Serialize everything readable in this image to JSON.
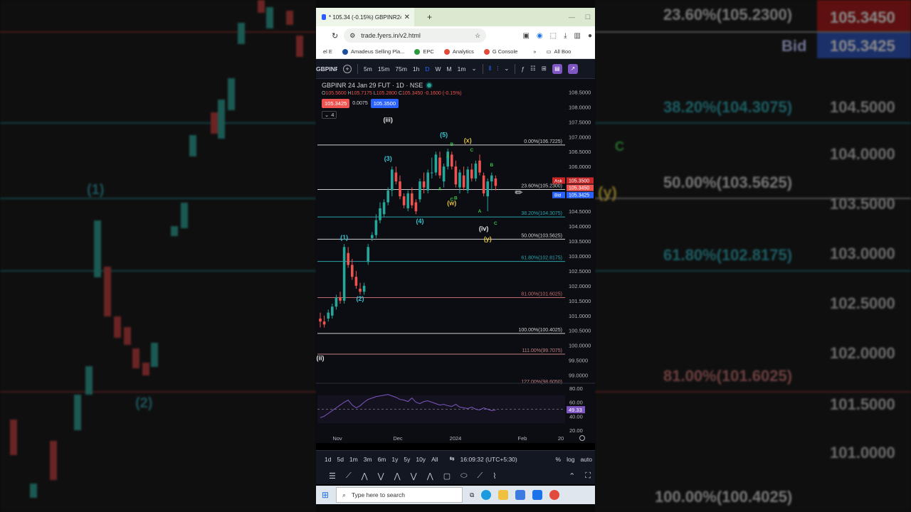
{
  "backdrop_left": {
    "labels": [
      {
        "text": "(1)",
        "color": "#2a8f9a"
      },
      {
        "text": "(2)",
        "color": "#2a8f9a"
      }
    ]
  },
  "backdrop_right": {
    "labels": [
      {
        "text": "23.60%(105.2300)",
        "color": "#d0d0d0"
      },
      {
        "text": "38.20%(104.3075)",
        "color": "#2aa3ad"
      },
      {
        "text": "50.00%(103.5625)",
        "color": "#d0d0d0"
      },
      {
        "text": "61.80%(102.8175)",
        "color": "#2aa3ad"
      },
      {
        "text": "81.00%(101.6025)",
        "color": "#c06b6b"
      },
      {
        "text": "100.00%(100.4025)",
        "color": "#d0d0d0"
      }
    ],
    "prices": [
      "104.5000",
      "104.0000",
      "103.5000",
      "103.0000",
      "102.5000",
      "102.0000",
      "101.5000",
      "101.0000"
    ],
    "bid_label": "Bid",
    "bid_value": "105.3425",
    "top_value": "105.3450",
    "wave_c": "C",
    "wave_y": "(y)"
  },
  "browser": {
    "tab_title": "* 105.34 (-0.15%) GBPINR24JAN",
    "url": "trade.fyers.in/v2.html",
    "bookmarks": [
      "el E",
      "Amadeus Selling Pla...",
      "EPC",
      "Analytics",
      "G Console",
      "All Boo"
    ]
  },
  "toolbar": {
    "symbol": "GBPINR",
    "intervals": [
      "5m",
      "15m",
      "75m",
      "1h",
      "D",
      "W",
      "M",
      "1m"
    ],
    "active_interval": "D"
  },
  "chart_header": {
    "title": "GBPINR 24 Jan 29 FUT · 1D · NSE",
    "o_label": "O",
    "o_value": "105.5600",
    "h_label": "H",
    "h_value": "105.7175",
    "l_label": "L",
    "l_value": "105.2800",
    "c_label": "C",
    "c_value": "105.3450",
    "change": "-0.1600 (-0.15%)",
    "sell_price": "105.3425",
    "spread": "0.0075",
    "buy_price": "105.3500",
    "indicator_count": "4"
  },
  "chart_data": {
    "type": "candlestick",
    "title": "GBPINR 24 Jan 29 FUT · 1D · NSE",
    "y_ticks": [
      "108.5000",
      "108.0000",
      "107.5000",
      "107.0000",
      "106.5000",
      "106.0000",
      "105.5000",
      "105.0000",
      "104.5000",
      "104.0000",
      "103.5000",
      "103.0000",
      "102.5000",
      "102.0000",
      "101.5000",
      "101.0000",
      "100.5000",
      "100.0000",
      "99.5000",
      "99.0000"
    ],
    "x_ticks": [
      "Nov",
      "Dec",
      "2024",
      "Feb",
      "20"
    ],
    "ylim": [
      98.8,
      108.7
    ],
    "candles": [
      [
        100.9,
        101.1,
        100.6,
        100.8
      ],
      [
        100.8,
        101.0,
        100.6,
        100.7
      ],
      [
        100.9,
        101.2,
        100.8,
        101.1
      ],
      [
        101.0,
        101.4,
        100.9,
        101.3
      ],
      [
        101.3,
        101.7,
        101.2,
        101.6
      ],
      [
        101.6,
        101.8,
        101.4,
        101.5
      ],
      [
        101.5,
        103.4,
        101.4,
        103.3
      ],
      [
        103.1,
        103.3,
        102.6,
        102.7
      ],
      [
        102.7,
        102.9,
        102.2,
        102.3
      ],
      [
        102.3,
        102.5,
        101.9,
        102.0
      ],
      [
        101.9,
        102.1,
        101.7,
        101.8
      ],
      [
        101.8,
        102.1,
        101.7,
        102.0
      ],
      [
        102.8,
        103.4,
        102.7,
        103.3
      ],
      [
        103.6,
        103.8,
        103.5,
        103.7
      ],
      [
        103.7,
        104.4,
        103.6,
        104.2
      ],
      [
        104.2,
        104.8,
        104.1,
        104.6
      ],
      [
        104.4,
        104.9,
        104.3,
        104.8
      ],
      [
        104.8,
        105.3,
        104.7,
        105.2
      ],
      [
        105.2,
        106.0,
        105.0,
        105.9
      ],
      [
        105.8,
        106.0,
        105.4,
        105.5
      ],
      [
        105.5,
        105.7,
        104.9,
        105.0
      ],
      [
        105.0,
        105.1,
        104.6,
        104.7
      ],
      [
        104.6,
        105.2,
        104.5,
        105.1
      ],
      [
        105.1,
        105.3,
        104.6,
        104.7
      ],
      [
        104.8,
        104.9,
        104.4,
        104.5
      ],
      [
        104.9,
        105.6,
        104.8,
        105.5
      ],
      [
        105.5,
        105.8,
        105.1,
        105.3
      ],
      [
        105.2,
        105.9,
        105.1,
        105.8
      ],
      [
        105.8,
        106.3,
        105.6,
        105.8
      ],
      [
        105.8,
        106.5,
        105.7,
        106.4
      ],
      [
        106.3,
        106.5,
        105.6,
        105.7
      ],
      [
        105.5,
        106.1,
        105.3,
        106.0
      ],
      [
        106.0,
        106.6,
        105.9,
        106.5
      ],
      [
        106.4,
        106.5,
        105.9,
        106.0
      ],
      [
        106.0,
        106.2,
        105.3,
        105.4
      ],
      [
        105.3,
        105.9,
        105.1,
        105.8
      ],
      [
        105.7,
        106.0,
        105.2,
        105.3
      ],
      [
        105.2,
        106.0,
        105.1,
        105.9
      ],
      [
        105.9,
        106.1,
        105.5,
        105.6
      ],
      [
        105.6,
        106.2,
        105.5,
        106.1
      ],
      [
        106.2,
        106.4,
        105.7,
        105.8
      ],
      [
        105.7,
        105.8,
        105.0,
        105.1
      ],
      [
        105.0,
        105.6,
        104.5,
        105.5
      ],
      [
        105.5,
        105.8,
        105.2,
        105.7
      ],
      [
        105.6,
        105.7,
        105.2,
        105.35
      ]
    ],
    "fib_levels": [
      {
        "label": "0.00%(106.7225)",
        "price": 106.7225,
        "color": "#cfcfcf"
      },
      {
        "label": "23.60%(105.2300)",
        "price": 105.23,
        "color": "#cfcfcf"
      },
      {
        "label": "38.20%(104.3075)",
        "price": 104.3075,
        "color": "#2aa3ad"
      },
      {
        "label": "50.00%(103.5625)",
        "price": 103.5625,
        "color": "#cfcfcf"
      },
      {
        "label": "61.80%(102.8175)",
        "price": 102.8175,
        "color": "#2aa3ad"
      },
      {
        "label": "81.00%(101.6025)",
        "price": 101.6025,
        "color": "#c06b6b"
      },
      {
        "label": "100.00%(100.4025)",
        "price": 100.4025,
        "color": "#cfcfcf"
      },
      {
        "label": "111.00%(99.7075)",
        "price": 99.7075,
        "color": "#c08080"
      }
    ],
    "wave_labels": [
      {
        "text": "(iii)",
        "color": "#e8e8e8",
        "price": 107.5,
        "candle": 17
      },
      {
        "text": "(ii)",
        "color": "#e8e8e8",
        "price": 99.5,
        "candle": 0
      },
      {
        "text": "(iv)",
        "color": "#e8e8e8",
        "price": 103.85,
        "candle": 41
      },
      {
        "text": "(w)",
        "color": "#e0c040",
        "price": 104.7,
        "candle": 33
      },
      {
        "text": "(x)",
        "color": "#e0c040",
        "price": 106.8,
        "candle": 37
      },
      {
        "text": "(y)",
        "color": "#e0c040",
        "price": 103.5,
        "candle": 42
      },
      {
        "text": "(1)",
        "color": "#35c4cf",
        "price": 103.55,
        "candle": 6
      },
      {
        "text": "(2)",
        "color": "#35c4cf",
        "price": 101.5,
        "candle": 10
      },
      {
        "text": "(3)",
        "color": "#35c4cf",
        "price": 106.2,
        "candle": 17
      },
      {
        "text": "(4)",
        "color": "#35c4cf",
        "price": 104.1,
        "candle": 25
      },
      {
        "text": "(5)",
        "color": "#35c4cf",
        "price": 107.0,
        "candle": 31
      },
      {
        "text": "A",
        "color": "#3ac24a",
        "price": 106.3,
        "candle": 32
      },
      {
        "text": "B",
        "color": "#3ac24a",
        "price": 106.7,
        "candle": 33
      },
      {
        "text": "C",
        "color": "#3ac24a",
        "price": 104.85,
        "candle": 33
      },
      {
        "text": "A",
        "color": "#3ac24a",
        "price": 105.2,
        "candle": 30
      },
      {
        "text": "B",
        "color": "#3ac24a",
        "price": 104.9,
        "candle": 34
      },
      {
        "text": "C",
        "color": "#3ac24a",
        "price": 106.5,
        "candle": 38
      },
      {
        "text": "B",
        "color": "#3ac24a",
        "price": 106.0,
        "candle": 43
      },
      {
        "text": "A",
        "color": "#3ac24a",
        "price": 104.45,
        "candle": 40
      },
      {
        "text": "C",
        "color": "#3ac24a",
        "price": 104.05,
        "candle": 44
      }
    ],
    "price_labels": {
      "ask_label": "Ask",
      "ask_value": "105.3500",
      "last_value": "105.3450",
      "bid_label": "Bid",
      "bid_value": "105.3425"
    },
    "partial_level": "127.00%(98.6050)"
  },
  "rsi": {
    "value": "49.33",
    "y_ticks": [
      "80.00",
      "60.00",
      "40.00",
      "20.00"
    ],
    "values": [
      38,
      40,
      44,
      48,
      52,
      56,
      60,
      63,
      56,
      52,
      55,
      60,
      64,
      66,
      68,
      69,
      70,
      71,
      69,
      67,
      64,
      63,
      61,
      66,
      60,
      58,
      61,
      62,
      60,
      58,
      56,
      57,
      55,
      54,
      57,
      53,
      52,
      51,
      53,
      50,
      49,
      52,
      50,
      48,
      49
    ]
  },
  "bottombar": {
    "ranges": [
      "1d",
      "5d",
      "1m",
      "3m",
      "6m",
      "1y",
      "5y",
      "10y",
      "All"
    ],
    "clock": "16:09:32 (UTC+5:30)",
    "percent": "%",
    "log": "log",
    "auto": "auto"
  },
  "taskbar": {
    "search_placeholder": "Type here to search"
  },
  "colors": {
    "up": "#26a69a",
    "down": "#ef5350",
    "bg": "#0b0d12",
    "accent": "#2962ff",
    "rsi": "#7e57c2"
  }
}
